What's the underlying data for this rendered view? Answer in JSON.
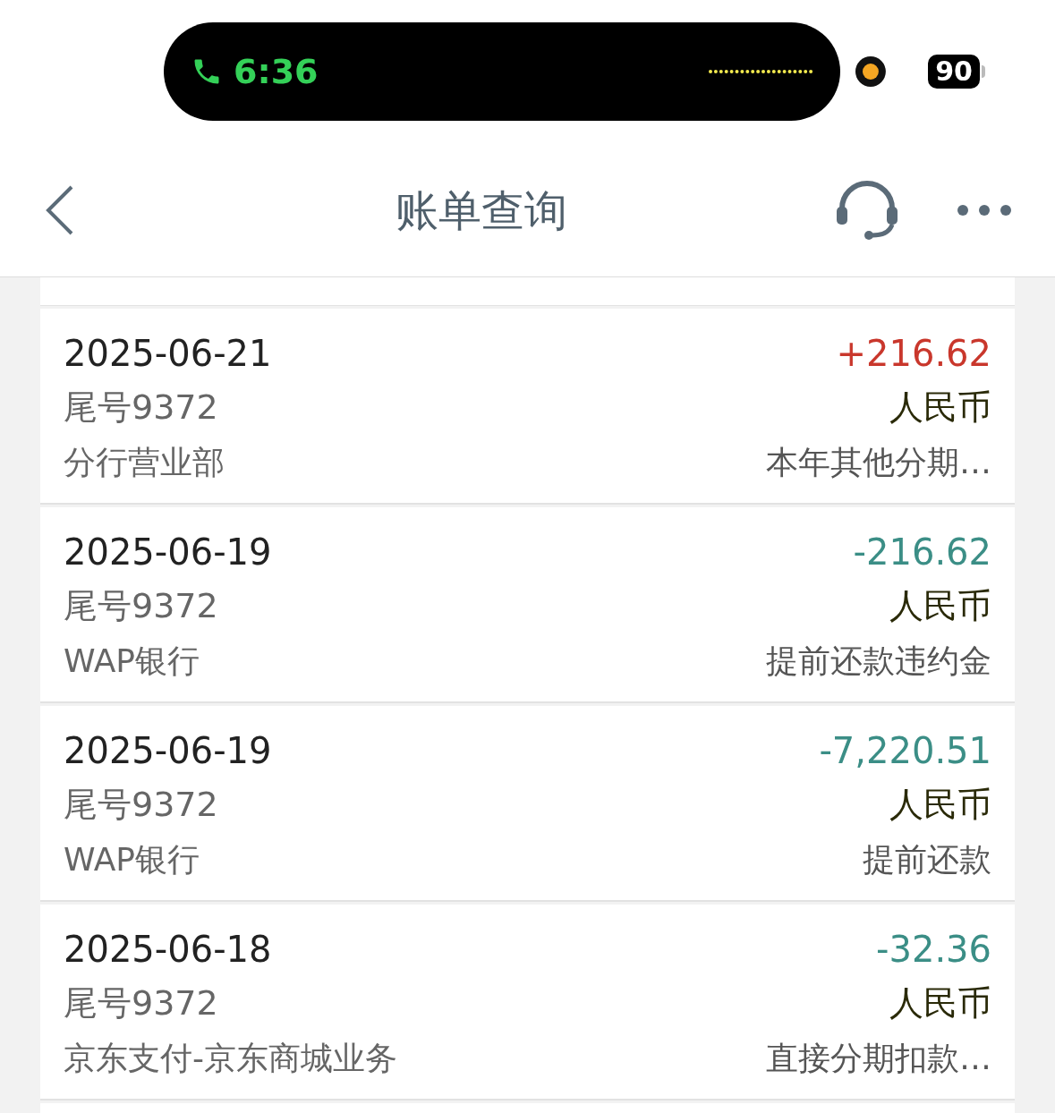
{
  "status_bar": {
    "time": "6:36",
    "battery": "90"
  },
  "header": {
    "title": "账单查询"
  },
  "transactions": [
    {
      "date": "2025-06-21",
      "amount": "+216.62",
      "kind": "credit",
      "card": "尾号9372",
      "currency": "人民币",
      "channel": "分行营业部",
      "description": "本年其他分期…"
    },
    {
      "date": "2025-06-19",
      "amount": "-216.62",
      "kind": "debit",
      "card": "尾号9372",
      "currency": "人民币",
      "channel": "WAP银行",
      "description": "提前还款违约金"
    },
    {
      "date": "2025-06-19",
      "amount": "-7,220.51",
      "kind": "debit",
      "card": "尾号9372",
      "currency": "人民币",
      "channel": "WAP银行",
      "description": "提前还款"
    },
    {
      "date": "2025-06-18",
      "amount": "-32.36",
      "kind": "debit",
      "card": "尾号9372",
      "currency": "人民币",
      "channel": "京东支付-京东商城业务",
      "description": "直接分期扣款…"
    }
  ]
}
